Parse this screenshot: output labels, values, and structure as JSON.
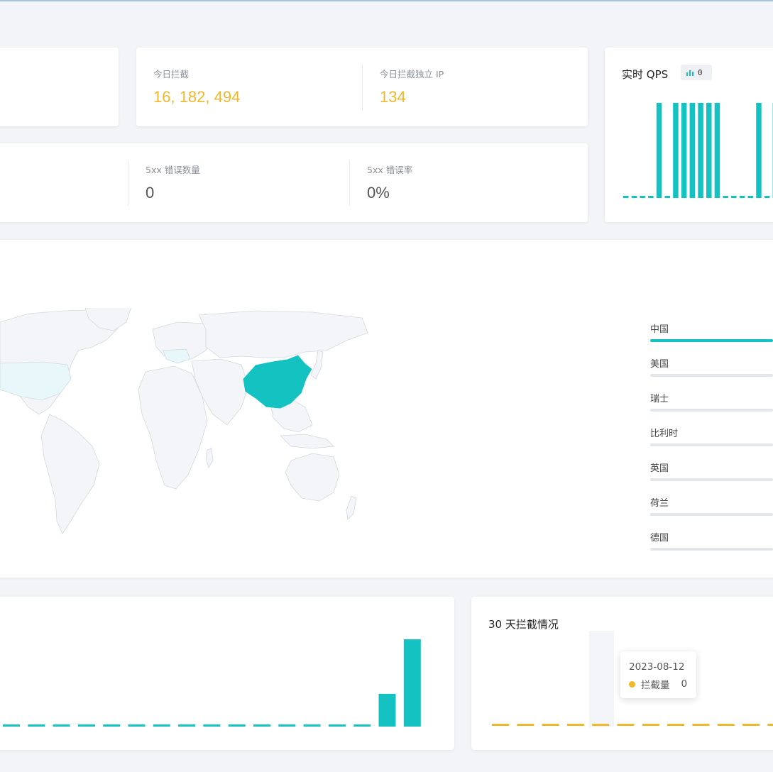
{
  "stats_row1": {
    "today_intercept_label": "今日拦截",
    "today_intercept_value": "16, 182, 494",
    "today_unique_ip_label": "今日拦截独立 IP",
    "today_unique_ip_value": "134"
  },
  "stats_row2": {
    "error_5xx_count_label": "5xx 错误数量",
    "error_5xx_count_value": "0",
    "error_5xx_rate_label": "5xx 错误率",
    "error_5xx_rate_value": "0%"
  },
  "qps": {
    "title": "实时 QPS",
    "value": "0",
    "icon": "bar-chart-icon"
  },
  "geo": {
    "highlight_color": "#15c2c2",
    "legend": [
      {
        "name": "中国",
        "share": 1.0
      },
      {
        "name": "美国",
        "share": 0
      },
      {
        "name": "瑞士",
        "share": 0
      },
      {
        "name": "比利时",
        "share": 0
      },
      {
        "name": "英国",
        "share": 0
      },
      {
        "name": "荷兰",
        "share": 0
      },
      {
        "name": "德国",
        "share": 0
      }
    ]
  },
  "thirty_day": {
    "title": "30 天拦截情况",
    "tooltip_date": "2023-08-12",
    "tooltip_series": "拦截量",
    "tooltip_value": "0"
  },
  "colors": {
    "accent": "#15c2c2",
    "warning": "#f1b82b"
  },
  "chart_data": [
    {
      "type": "bar",
      "name_ref": "qps",
      "values": [
        0,
        0,
        0,
        0,
        1,
        0,
        1,
        1,
        1,
        1,
        1,
        1,
        0,
        0,
        0,
        0,
        1,
        0,
        1
      ]
    },
    {
      "type": "bar",
      "name_ref": "left-bottom",
      "values": [
        0,
        0,
        0,
        0,
        0,
        0,
        0,
        0,
        0,
        0,
        0,
        0,
        0,
        0,
        0,
        30,
        80
      ]
    },
    {
      "type": "line",
      "name_ref": "thirty_day",
      "values": [
        0,
        0,
        0,
        0,
        0,
        0,
        0,
        0,
        0,
        0,
        0,
        0
      ]
    }
  ]
}
